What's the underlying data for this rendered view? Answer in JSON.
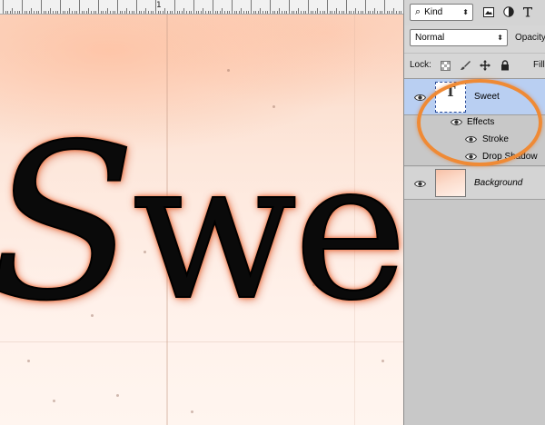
{
  "ruler": {
    "marker": "1"
  },
  "canvas": {
    "text_cap": "S",
    "text_rest": "weet"
  },
  "toolbar": {
    "filter_kind": "Kind",
    "filter_icons": [
      "image-filter-icon",
      "adjustment-filter-icon",
      "type-filter-icon"
    ],
    "blend_mode": "Normal",
    "opacity_label": "Opacity",
    "lock_label": "Lock:",
    "lock_icons": [
      "lock-transparent-icon",
      "lock-brush-icon",
      "lock-move-icon",
      "lock-all-icon"
    ],
    "fill_label": "Fill"
  },
  "layers": [
    {
      "name": "Sweet",
      "type": "text",
      "selected": true,
      "thumb_glyph": "T",
      "effects_label": "Effects",
      "effects": [
        "Stroke",
        "Drop Shadow"
      ]
    },
    {
      "name": "Background",
      "type": "image",
      "selected": false
    }
  ],
  "colors": {
    "selected_layer": "#b9cff2",
    "highlight_ring": "#ef8a35",
    "text_stroke": "#f26a36"
  }
}
